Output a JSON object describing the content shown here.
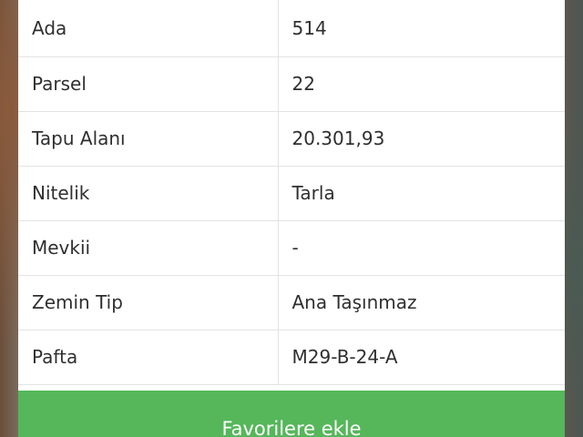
{
  "details": {
    "rows": [
      {
        "label": "Ada",
        "value": "514"
      },
      {
        "label": "Parsel",
        "value": "22"
      },
      {
        "label": "Tapu Alanı",
        "value": "20.301,93"
      },
      {
        "label": "Nitelik",
        "value": "Tarla"
      },
      {
        "label": "Mevkii",
        "value": "-"
      },
      {
        "label": "Zemin Tip",
        "value": "Ana Taşınmaz"
      },
      {
        "label": "Pafta",
        "value": "M29-B-24-A"
      }
    ]
  },
  "actions": {
    "favorite_label": "Favorilere ekle"
  },
  "colors": {
    "button_green": "#55b75a",
    "text": "#2f2f2f",
    "divider": "#e3e3e3"
  }
}
